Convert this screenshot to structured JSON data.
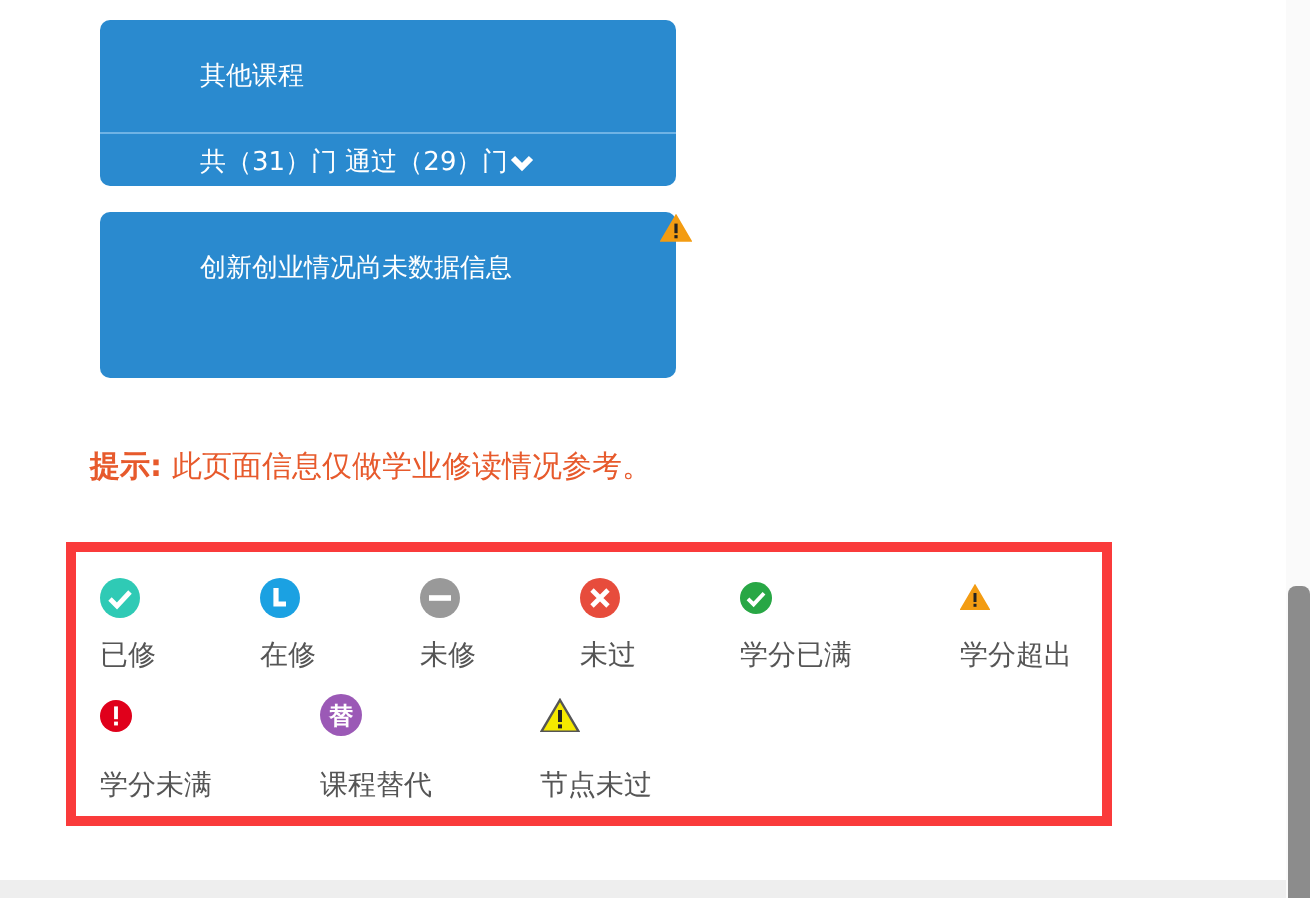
{
  "cards": [
    {
      "title": "其他课程",
      "summary": "共（31）门 通过（29）门",
      "warning": false
    },
    {
      "title": "创新创业情况尚未数据信息",
      "warning": true
    }
  ],
  "hint": {
    "label": "提示:",
    "text": "此页面信息仅做学业修读情况参考。"
  },
  "legend": [
    {
      "kind": "done",
      "label": "已修"
    },
    {
      "kind": "ongoing",
      "label": "在修"
    },
    {
      "kind": "none",
      "label": "未修"
    },
    {
      "kind": "failed",
      "label": "未过"
    },
    {
      "kind": "full",
      "label": "学分已满"
    },
    {
      "kind": "exceed",
      "label": "学分超出"
    },
    {
      "kind": "short",
      "label": "学分未满"
    },
    {
      "kind": "substitute",
      "label": "课程替代",
      "glyph": "替"
    },
    {
      "kind": "node",
      "label": "节点未过"
    }
  ]
}
